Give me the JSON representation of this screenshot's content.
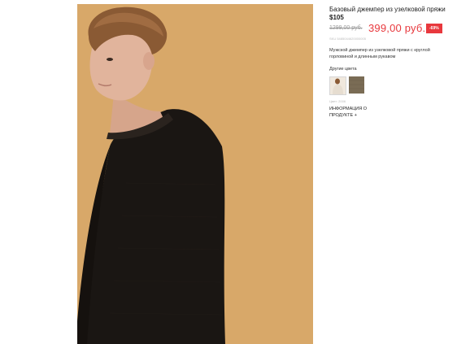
{
  "product": {
    "title_text": "Базовый джемпер из узелковой пряжи",
    "title_code": "$105",
    "old_price": "1299,00 руб.",
    "new_price": "399,00 руб.",
    "discount": "-69%",
    "sku": "SKU 5485044620000005",
    "description": "Мужской джемпер из узелковой пряжи с круглой горловиной и длинным рукавом",
    "colors_label": "Другие цвета",
    "color_note": "Цвет: 2006",
    "more_info": "ИНФОРМАЦИЯ О ПРОДУКТЕ +"
  },
  "colors": {
    "background": "#d9a96a",
    "sweater": "#1a1613",
    "sale_red": "#e8383d",
    "swatch_light": "#e9e1d6",
    "swatch_khaki": "#7a6c55"
  }
}
